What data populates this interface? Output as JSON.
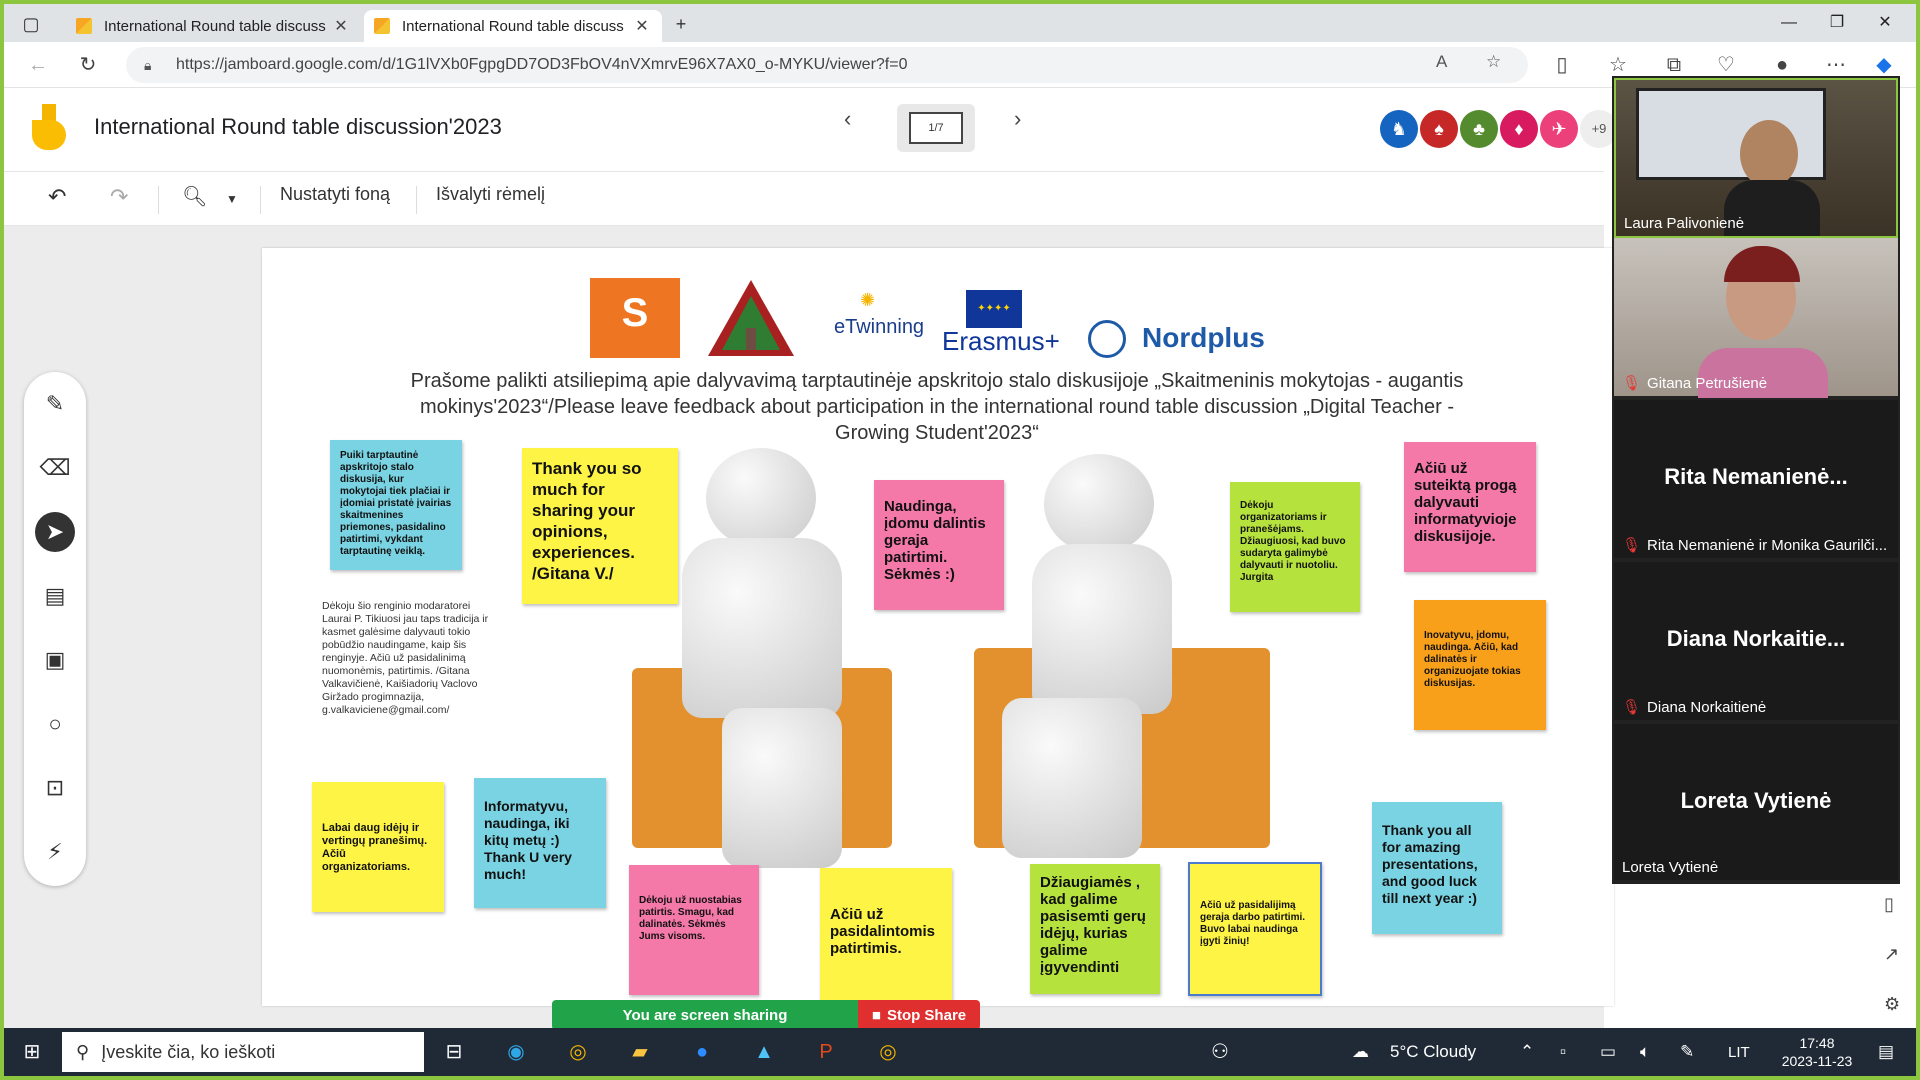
{
  "browser": {
    "tabs": [
      {
        "title": "International Round table discuss"
      },
      {
        "title": "International Round table discuss"
      }
    ],
    "url": "https://jamboard.google.com/d/1G1lVXb0FgpgDD7OD3FbOV4nVXmrvE96X7AX0_o-MYKU/viewer?f=0"
  },
  "jamboard": {
    "title": "International Round table discussion'2023",
    "frame_counter": "1/7",
    "collaborators_more": "+9",
    "toolbar": {
      "set_background": "Nustatyti foną",
      "clear_frame": "Išvalyti rėmelį"
    }
  },
  "board": {
    "logos": {
      "twinning": "eTwinning",
      "erasmus": "Erasmus+",
      "nordplus": "Nordplus"
    },
    "heading": "Prašome palikti atsiliepimą apie dalyvavimą tarptautinėje apskritojo stalo diskusijoje „Skaitmeninis mokytojas - augantis mokinys'2023“/Please leave feedback about participation in the international round table discussion „Digital Teacher - Growing Student'2023“",
    "notes": {
      "n1": "Puiki tarptautinė apskritojo stalo diskusija, kur mokytojai tiek plačiai ir įdomiai pristatė įvairias skaitmenines priemones, pasidalino patirtimi, vykdant tarptautinę veiklą.",
      "n2": "Thank you so much for sharing your opinions, experiences. /Gitana V./",
      "n3": "Naudinga, įdomu dalintis geraja patirtimi. Sėkmės :)",
      "n4": "Dėkoju organizatoriams ir pranešėjams. Džiaugiuosi, kad buvo sudaryta galimybė dalyvauti ir nuotoliu. Jurgita",
      "n5": "Ačiū už suteiktą progą dalyvauti informatyvioje diskusijoje.",
      "n6": "Dėkoju šio renginio modaratorei Laurai P. Tikiuosi jau taps tradicija ir kasmet galėsime dalyvauti tokio pobūdžio naudingame, kaip šis renginyje. Ačiū už pasidalinimą nuomonėmis, patirtimis. /Gitana Valkavičienė, Kaišiadorių Vaclovo Giržado progimnazija, g.valkaviciene@gmail.com/",
      "n7": "Inovatyvu, įdomu, naudinga. Ačiū, kad dalinatės ir organizuojate tokias diskusijas.",
      "n8": "Labai daug idėjų ir vertingų pranešimų. Ačiū organizatoriams.",
      "n9": "Informatyvu, naudinga, iki kitų metų :) Thank U very much!",
      "n10": "Dėkoju už nuostabias patirtis. Smagu, kad dalinatės. Sėkmės Jums visoms.",
      "n11": "Ačiū už pasidalintomis patirtimis.",
      "n12": "Džiaugiamės , kad galime pasisemti gerų idėjų, kurias galime įgyvendinti",
      "n13": "Ačiū už pasidalijimą geraja darbo patirtimi. Buvo labai naudinga įgyti žinių!",
      "n14": "Thank you all for amazing presentations, and good luck till next year :)"
    }
  },
  "meeting": {
    "participants": [
      {
        "name": "Laura Palivonienė"
      },
      {
        "name": "Gitana Petrušienė"
      },
      {
        "big": "Rita  Nemanienė...",
        "name": "Rita Nemanienė ir Monika Gaurilči..."
      },
      {
        "big": "Diana  Norkaitie...",
        "name": "Diana Norkaitienė"
      },
      {
        "big": "Loreta Vytienė",
        "name": "Loreta Vytienė"
      }
    ]
  },
  "share_banner": {
    "sharing": "You are screen sharing",
    "stop": "Stop Share"
  },
  "taskbar": {
    "search_placeholder": "Įveskite čia, ko ieškoti",
    "weather": "5°C  Cloudy",
    "lang": "LIT",
    "time": "17:48",
    "date": "2023-11-23"
  }
}
